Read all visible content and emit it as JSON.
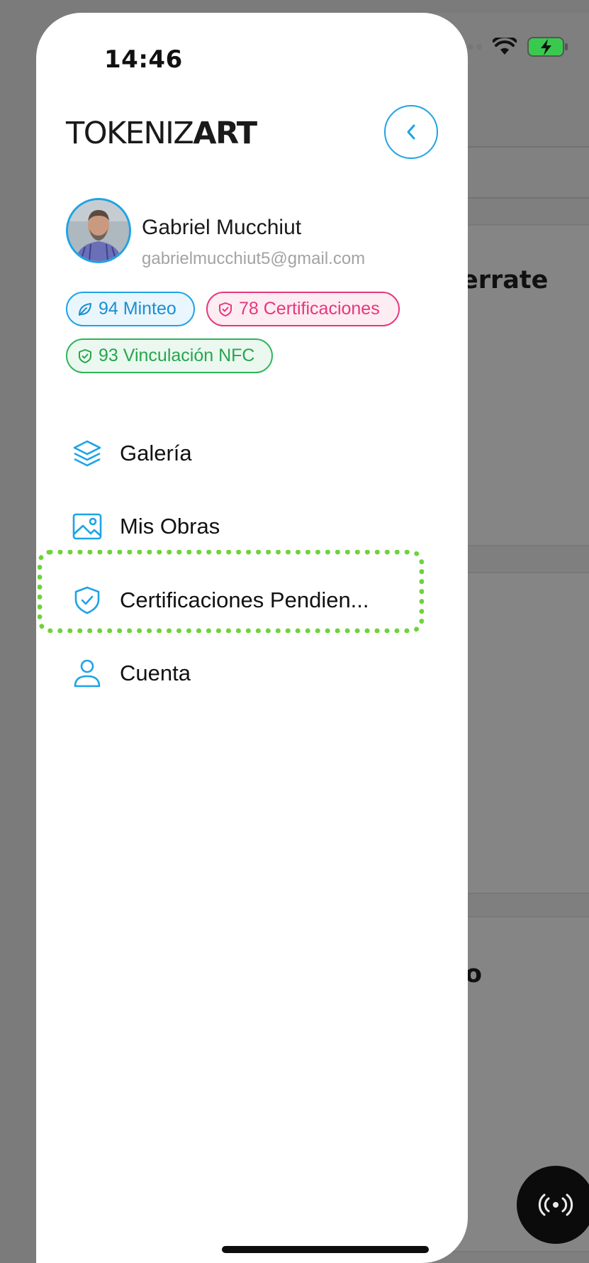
{
  "status_bar": {
    "time": "14:46"
  },
  "drawer": {
    "logo": {
      "part1": "TOKENIZ",
      "part2": "ART"
    },
    "back_icon": "chevron-left-icon",
    "user": {
      "name": "Gabriel Mucchiut",
      "email": "gabrielmucchiut5@gmail.com"
    },
    "stats": [
      {
        "label": "94 Minteo",
        "icon": "leaf-icon",
        "color": "#1ea3e6"
      },
      {
        "label": "78 Certificaciones",
        "icon": "shield-icon",
        "color": "#e4387c"
      },
      {
        "label": "93 Vinculación NFC",
        "icon": "shield-icon",
        "color": "#2fb45a"
      }
    ],
    "menu": [
      {
        "label": "Galería",
        "icon": "layers-icon"
      },
      {
        "label": "Mis Obras",
        "icon": "image-icon"
      },
      {
        "label": "Certificaciones Pendien...",
        "icon": "shield-check-icon"
      },
      {
        "label": "Cuenta",
        "icon": "user-icon"
      }
    ],
    "accent_color": "#1ea3e6",
    "highlight_color": "#6fd23b"
  },
  "background": {
    "card1_title": "errate",
    "card3_title": "o",
    "fab_icon": "nfc-signal-icon"
  }
}
